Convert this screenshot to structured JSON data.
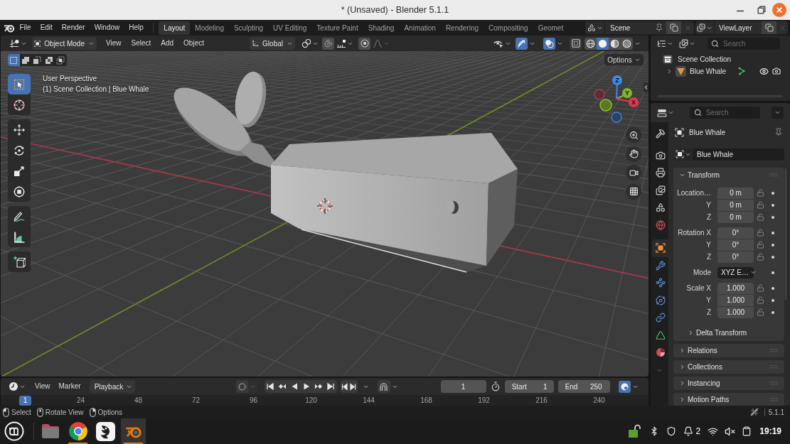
{
  "window": {
    "title": "* (Unsaved) - Blender 5.1.1"
  },
  "top_bar": {
    "menus": [
      "File",
      "Edit",
      "Render",
      "Window",
      "Help"
    ],
    "workspaces": [
      {
        "label": "Layout",
        "selected": true
      },
      {
        "label": "Modeling",
        "selected": false
      },
      {
        "label": "Sculpting",
        "selected": false
      },
      {
        "label": "UV Editing",
        "selected": false
      },
      {
        "label": "Texture Paint",
        "selected": false
      },
      {
        "label": "Shading",
        "selected": false
      },
      {
        "label": "Animation",
        "selected": false
      },
      {
        "label": "Rendering",
        "selected": false
      },
      {
        "label": "Compositing",
        "selected": false
      },
      {
        "label": "Geomet",
        "selected": false
      }
    ],
    "scene": "Scene",
    "view_layer": "ViewLayer"
  },
  "viewport": {
    "mode": "Object Mode",
    "menus": [
      "View",
      "Select",
      "Add",
      "Object"
    ],
    "orientation": "Global",
    "snap": {
      "on": false
    },
    "proportional_editing": {
      "on": false
    },
    "gizmos": {
      "on": true
    },
    "overlays": {
      "on": true
    },
    "xray": {
      "on": false
    },
    "shading_modes": [
      {
        "kind": "wireframe",
        "selected": false
      },
      {
        "kind": "solid",
        "selected": true
      },
      {
        "kind": "material",
        "selected": false
      },
      {
        "kind": "rendered",
        "selected": false
      }
    ],
    "select_modes": [
      {
        "kind": "new",
        "selected": true
      },
      {
        "kind": "extend",
        "selected": false
      },
      {
        "kind": "subtract",
        "selected": false
      },
      {
        "kind": "invert",
        "selected": false
      },
      {
        "kind": "intersect",
        "selected": false
      }
    ],
    "options": "Options",
    "view_name": "User Perspective",
    "view_context": "(1) Scene Collection | Blue Whale",
    "tool_groups": [
      {
        "tools": [
          {
            "kind": "select_box",
            "selected": true
          },
          {
            "kind": "cursor",
            "selected": false
          }
        ]
      },
      {
        "tools": [
          {
            "kind": "move",
            "selected": false
          },
          {
            "kind": "rotate",
            "selected": false
          },
          {
            "kind": "scale",
            "selected": false
          },
          {
            "kind": "transform",
            "selected": false
          }
        ]
      },
      {
        "tools": [
          {
            "kind": "annotate",
            "selected": false
          },
          {
            "kind": "measure",
            "selected": false
          }
        ]
      },
      {
        "tools": [
          {
            "kind": "add_cube",
            "selected": false
          }
        ]
      }
    ],
    "gizmo_axes": [
      {
        "label": "Z"
      },
      {
        "label": "Y"
      },
      {
        "label": "X"
      }
    ],
    "navigation": [
      {
        "kind": "zoom"
      },
      {
        "kind": "pan"
      },
      {
        "kind": "camera"
      },
      {
        "kind": "orthographic"
      }
    ]
  },
  "outliner": {
    "search": {
      "placeholder": "Search"
    },
    "tree": [
      {
        "kind": "collection",
        "label": "Scene Collection",
        "children": [
          {
            "kind": "mesh_object",
            "label": "Blue Whale",
            "expanded": false
          }
        ]
      }
    ]
  },
  "properties": {
    "search": {
      "placeholder": "Search"
    },
    "tab_groups": [
      {
        "tabs": [
          {
            "kind": "tool",
            "selected": false
          }
        ]
      },
      {
        "tabs": [
          {
            "kind": "render",
            "selected": false
          },
          {
            "kind": "output",
            "selected": false
          },
          {
            "kind": "view_layer",
            "selected": false
          },
          {
            "kind": "scene",
            "selected": false
          },
          {
            "kind": "world",
            "selected": false
          }
        ]
      },
      {
        "tabs": [
          {
            "kind": "object",
            "selected": true
          },
          {
            "kind": "modifiers",
            "selected": false
          },
          {
            "kind": "particles",
            "selected": false
          },
          {
            "kind": "physics",
            "selected": false
          },
          {
            "kind": "constraints",
            "selected": false
          },
          {
            "kind": "data",
            "selected": false
          },
          {
            "kind": "material",
            "selected": false
          }
        ]
      }
    ],
    "object_name": "Blue Whale",
    "datablock": "Blue Whale",
    "panels": [
      {
        "title": "Transform",
        "expanded": true,
        "groups": [
          {
            "rows": [
              {
                "kind": "number",
                "label": "Location…",
                "value": "0 m"
              },
              {
                "kind": "number",
                "label": "Y",
                "value": "0 m"
              },
              {
                "kind": "number",
                "label": "Z",
                "value": "0 m"
              }
            ]
          },
          {
            "rows": [
              {
                "kind": "number",
                "label": "Rotation X",
                "value": "0°"
              },
              {
                "kind": "number",
                "label": "Y",
                "value": "0°"
              },
              {
                "kind": "number",
                "label": "Z",
                "value": "0°"
              }
            ]
          },
          {
            "rows": [
              {
                "kind": "dropdown",
                "label": "Mode",
                "value": "XYZ E…"
              }
            ]
          },
          {
            "rows": [
              {
                "kind": "number",
                "label": "Scale X",
                "value": "1.000"
              },
              {
                "kind": "number",
                "label": "Y",
                "value": "1.000"
              },
              {
                "kind": "number",
                "label": "Z",
                "value": "1.000"
              }
            ]
          }
        ],
        "subpanels": [
          {
            "title": "Delta Transform",
            "expanded": false
          }
        ]
      },
      {
        "title": "Relations",
        "expanded": false
      },
      {
        "title": "Collections",
        "expanded": false
      },
      {
        "title": "Instancing",
        "expanded": false
      },
      {
        "title": "Motion Paths",
        "expanded": false
      }
    ]
  },
  "timeline": {
    "menus": [
      "View",
      "Marker"
    ],
    "playback": "Playback",
    "current_frame": "1",
    "start": {
      "label": "Start",
      "value": "1"
    },
    "end": {
      "label": "End",
      "value": "250"
    },
    "ruler": [
      {
        "label": "1",
        "selected": true
      },
      {
        "label": "24",
        "selected": false
      },
      {
        "label": "48",
        "selected": false
      },
      {
        "label": "72",
        "selected": false
      },
      {
        "label": "96",
        "selected": false
      },
      {
        "label": "120",
        "selected": false
      },
      {
        "label": "144",
        "selected": false
      },
      {
        "label": "168",
        "selected": false
      },
      {
        "label": "192",
        "selected": false
      },
      {
        "label": "216",
        "selected": false
      },
      {
        "label": "240",
        "selected": false
      }
    ]
  },
  "status_bar": {
    "hints": [
      {
        "kind": "left_click",
        "label": "Select"
      },
      {
        "kind": "middle_click",
        "label": "Rotate View"
      },
      {
        "kind": "right_click",
        "label": "Options"
      }
    ],
    "version": "5.1.1"
  },
  "taskbar": {
    "apps": [
      {
        "kind": "files",
        "running": false,
        "selected": false
      },
      {
        "kind": "browser",
        "running": true,
        "selected": false
      },
      {
        "kind": "app",
        "running": false,
        "selected": false
      },
      {
        "kind": "blender",
        "running": true,
        "selected": true
      }
    ],
    "notifications": "2",
    "clock": "19:19"
  }
}
